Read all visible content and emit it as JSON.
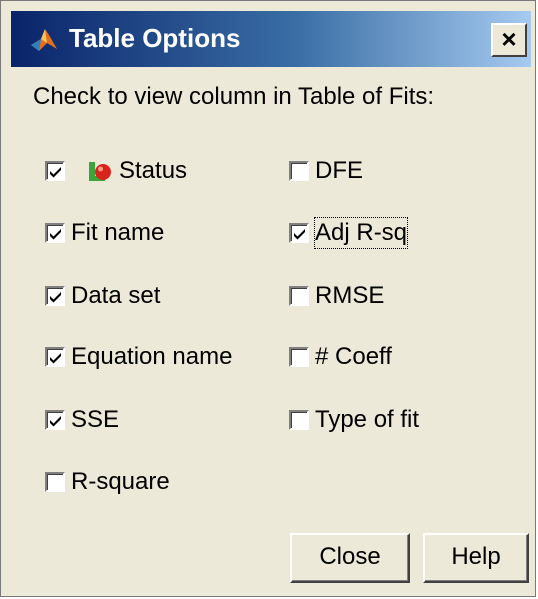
{
  "window": {
    "title": "Table Options",
    "close_label": "×"
  },
  "instruction": "Check to view column in Table of Fits:",
  "left_options": [
    {
      "label": "Status",
      "checked": true,
      "icon": "status-red-dot-icon"
    },
    {
      "label": "Fit name",
      "checked": true
    },
    {
      "label": "Data set",
      "checked": true
    },
    {
      "label": "Equation name",
      "checked": true
    },
    {
      "label": "SSE",
      "checked": true
    },
    {
      "label": "R-square",
      "checked": false
    }
  ],
  "right_options": [
    {
      "label": "DFE",
      "checked": false
    },
    {
      "label": "Adj R-sq",
      "checked": true,
      "focused": true
    },
    {
      "label": "RMSE",
      "checked": false
    },
    {
      "label": "# Coeff",
      "checked": false
    },
    {
      "label": "Type of fit",
      "checked": false
    }
  ],
  "buttons": {
    "close_label": "Close",
    "help_label": "Help"
  },
  "colors": {
    "titlebar_start": "#0a246a",
    "titlebar_end": "#a6caf0",
    "dialog_bg": "#ece9d8"
  }
}
